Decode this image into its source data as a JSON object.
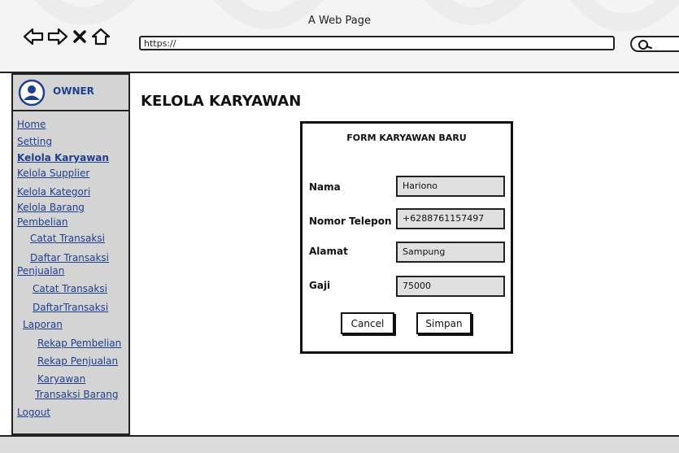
{
  "browser": {
    "window_title": "A Web Page",
    "url": "https://"
  },
  "sidebar": {
    "owner_label": "OWNER",
    "items": [
      {
        "label": "Home",
        "bold": false
      },
      {
        "label": "Setting",
        "bold": false
      },
      {
        "label": "Kelola Karyawan",
        "bold": true
      },
      {
        "label": "Kelola Supplier",
        "bold": false
      },
      {
        "label": "Kelola Kategori",
        "bold": false
      },
      {
        "label": "Kelola Barang",
        "bold": false
      },
      {
        "label": "Pembelian",
        "bold": false
      },
      {
        "label": "Catat Transaksi",
        "bold": false
      },
      {
        "label": "Daftar Transaksi",
        "bold": false
      },
      {
        "label": "Penjualan",
        "bold": false
      },
      {
        "label": "Catat Transaksi",
        "bold": false
      },
      {
        "label": "DaftarTransaksi",
        "bold": false
      },
      {
        "label": "Laporan",
        "bold": false
      },
      {
        "label": "Rekap Pembelian",
        "bold": false
      },
      {
        "label": "Rekap Penjualan",
        "bold": false
      },
      {
        "label": "Karyawan",
        "bold": false
      },
      {
        "label": "Transaksi Barang",
        "bold": false
      },
      {
        "label": "Logout",
        "bold": false
      }
    ]
  },
  "main": {
    "page_title": "KELOLA KARYAWAN",
    "form": {
      "title": "FORM KARYAWAN BARU",
      "fields": [
        {
          "label": "Nama",
          "value": "Hariono"
        },
        {
          "label": "Nomor Telepon",
          "value": "+6288761157497"
        },
        {
          "label": "Alamat",
          "value": "Sampung"
        },
        {
          "label": "Gaji",
          "value": "75000"
        }
      ],
      "cancel_label": "Cancel",
      "save_label": "Simpan"
    }
  },
  "colors": {
    "link": "#1f3f8f",
    "sidebar_bg": "#d4d4d4",
    "field_bg": "#e0e0e0"
  }
}
